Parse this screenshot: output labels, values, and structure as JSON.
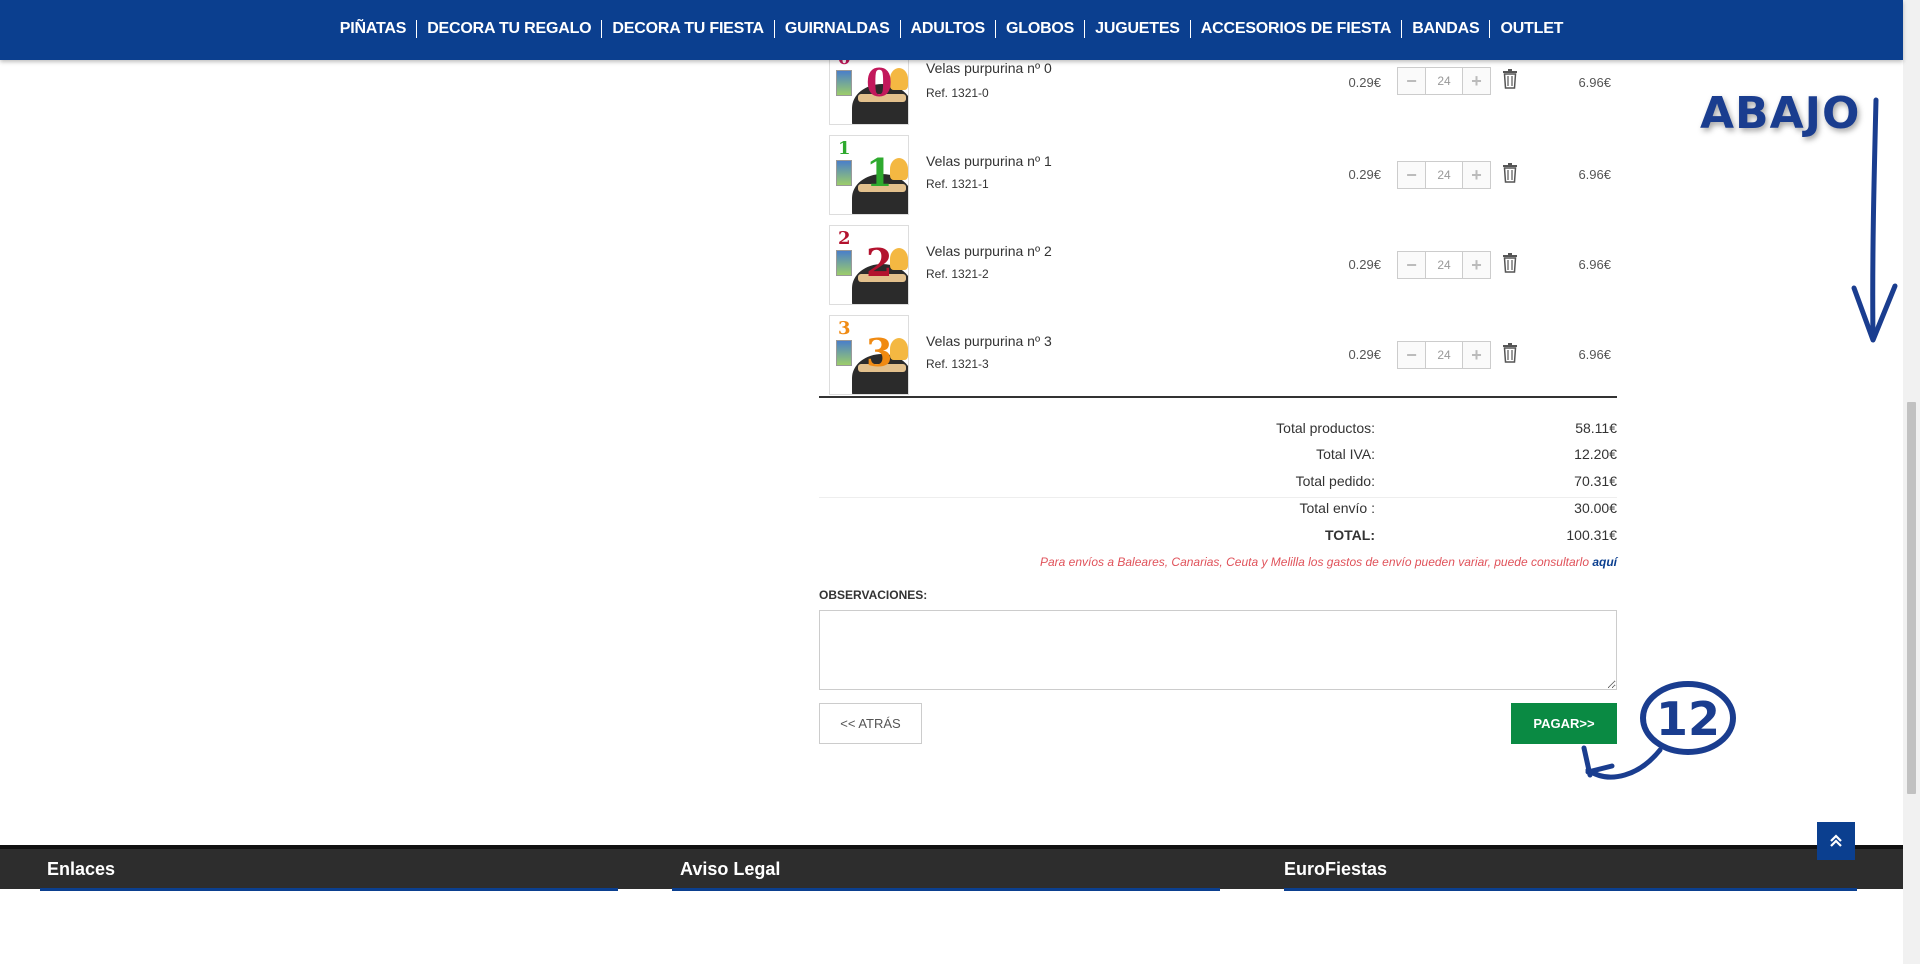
{
  "nav": {
    "items": [
      "PIÑATAS",
      "DECORA TU REGALO",
      "DECORA TU FIESTA",
      "GUIRNALDAS",
      "ADULTOS",
      "GLOBOS",
      "JUGUETES",
      "ACCESORIOS DE FIESTA",
      "BANDAS",
      "OUTLET"
    ]
  },
  "cart": {
    "items": [
      {
        "name": "Velas purpurina nº 0",
        "ref": "Ref. 1321-0",
        "unit_price": "0.29€",
        "qty": "24",
        "total": "6.96€",
        "digit": "0",
        "color": "#c2185b"
      },
      {
        "name": "Velas purpurina nº 1",
        "ref": "Ref. 1321-1",
        "unit_price": "0.29€",
        "qty": "24",
        "total": "6.96€",
        "digit": "1",
        "color": "#2eaa2e"
      },
      {
        "name": "Velas purpurina nº 2",
        "ref": "Ref. 1321-2",
        "unit_price": "0.29€",
        "qty": "24",
        "total": "6.96€",
        "digit": "2",
        "color": "#b3122e"
      },
      {
        "name": "Velas purpurina nº 3",
        "ref": "Ref. 1321-3",
        "unit_price": "0.29€",
        "qty": "24",
        "total": "6.96€",
        "digit": "3",
        "color": "#f08a12"
      }
    ]
  },
  "totals": {
    "productos_label": "Total productos:",
    "productos": "58.11€",
    "iva_label": "Total IVA:",
    "iva": "12.20€",
    "pedido_label": "Total pedido:",
    "pedido": "70.31€",
    "envio_label": "Total envío :",
    "envio": "30.00€",
    "total_label": "TOTAL:",
    "total": "100.31€"
  },
  "shipping_note": {
    "text": "Para envíos a Baleares, Canarias, Ceuta y Melilla los gastos de envío pueden variar, puede consultarlo ",
    "link": "aquí"
  },
  "observaciones": {
    "label": "OBSERVACIONES:",
    "value": ""
  },
  "buttons": {
    "back": "<< ATRÁS",
    "pay": "PAGAR>>"
  },
  "footer": {
    "enlaces": "Enlaces",
    "aviso": "Aviso Legal",
    "brand": "EuroFiestas"
  },
  "annotations": {
    "down_label": "ABAJO",
    "step": "12"
  },
  "colors": {
    "nav_bg": "#0b3f8f",
    "pay_btn": "#0a8a43",
    "note": "#e0525a",
    "annotation": "#1a3d8f"
  }
}
